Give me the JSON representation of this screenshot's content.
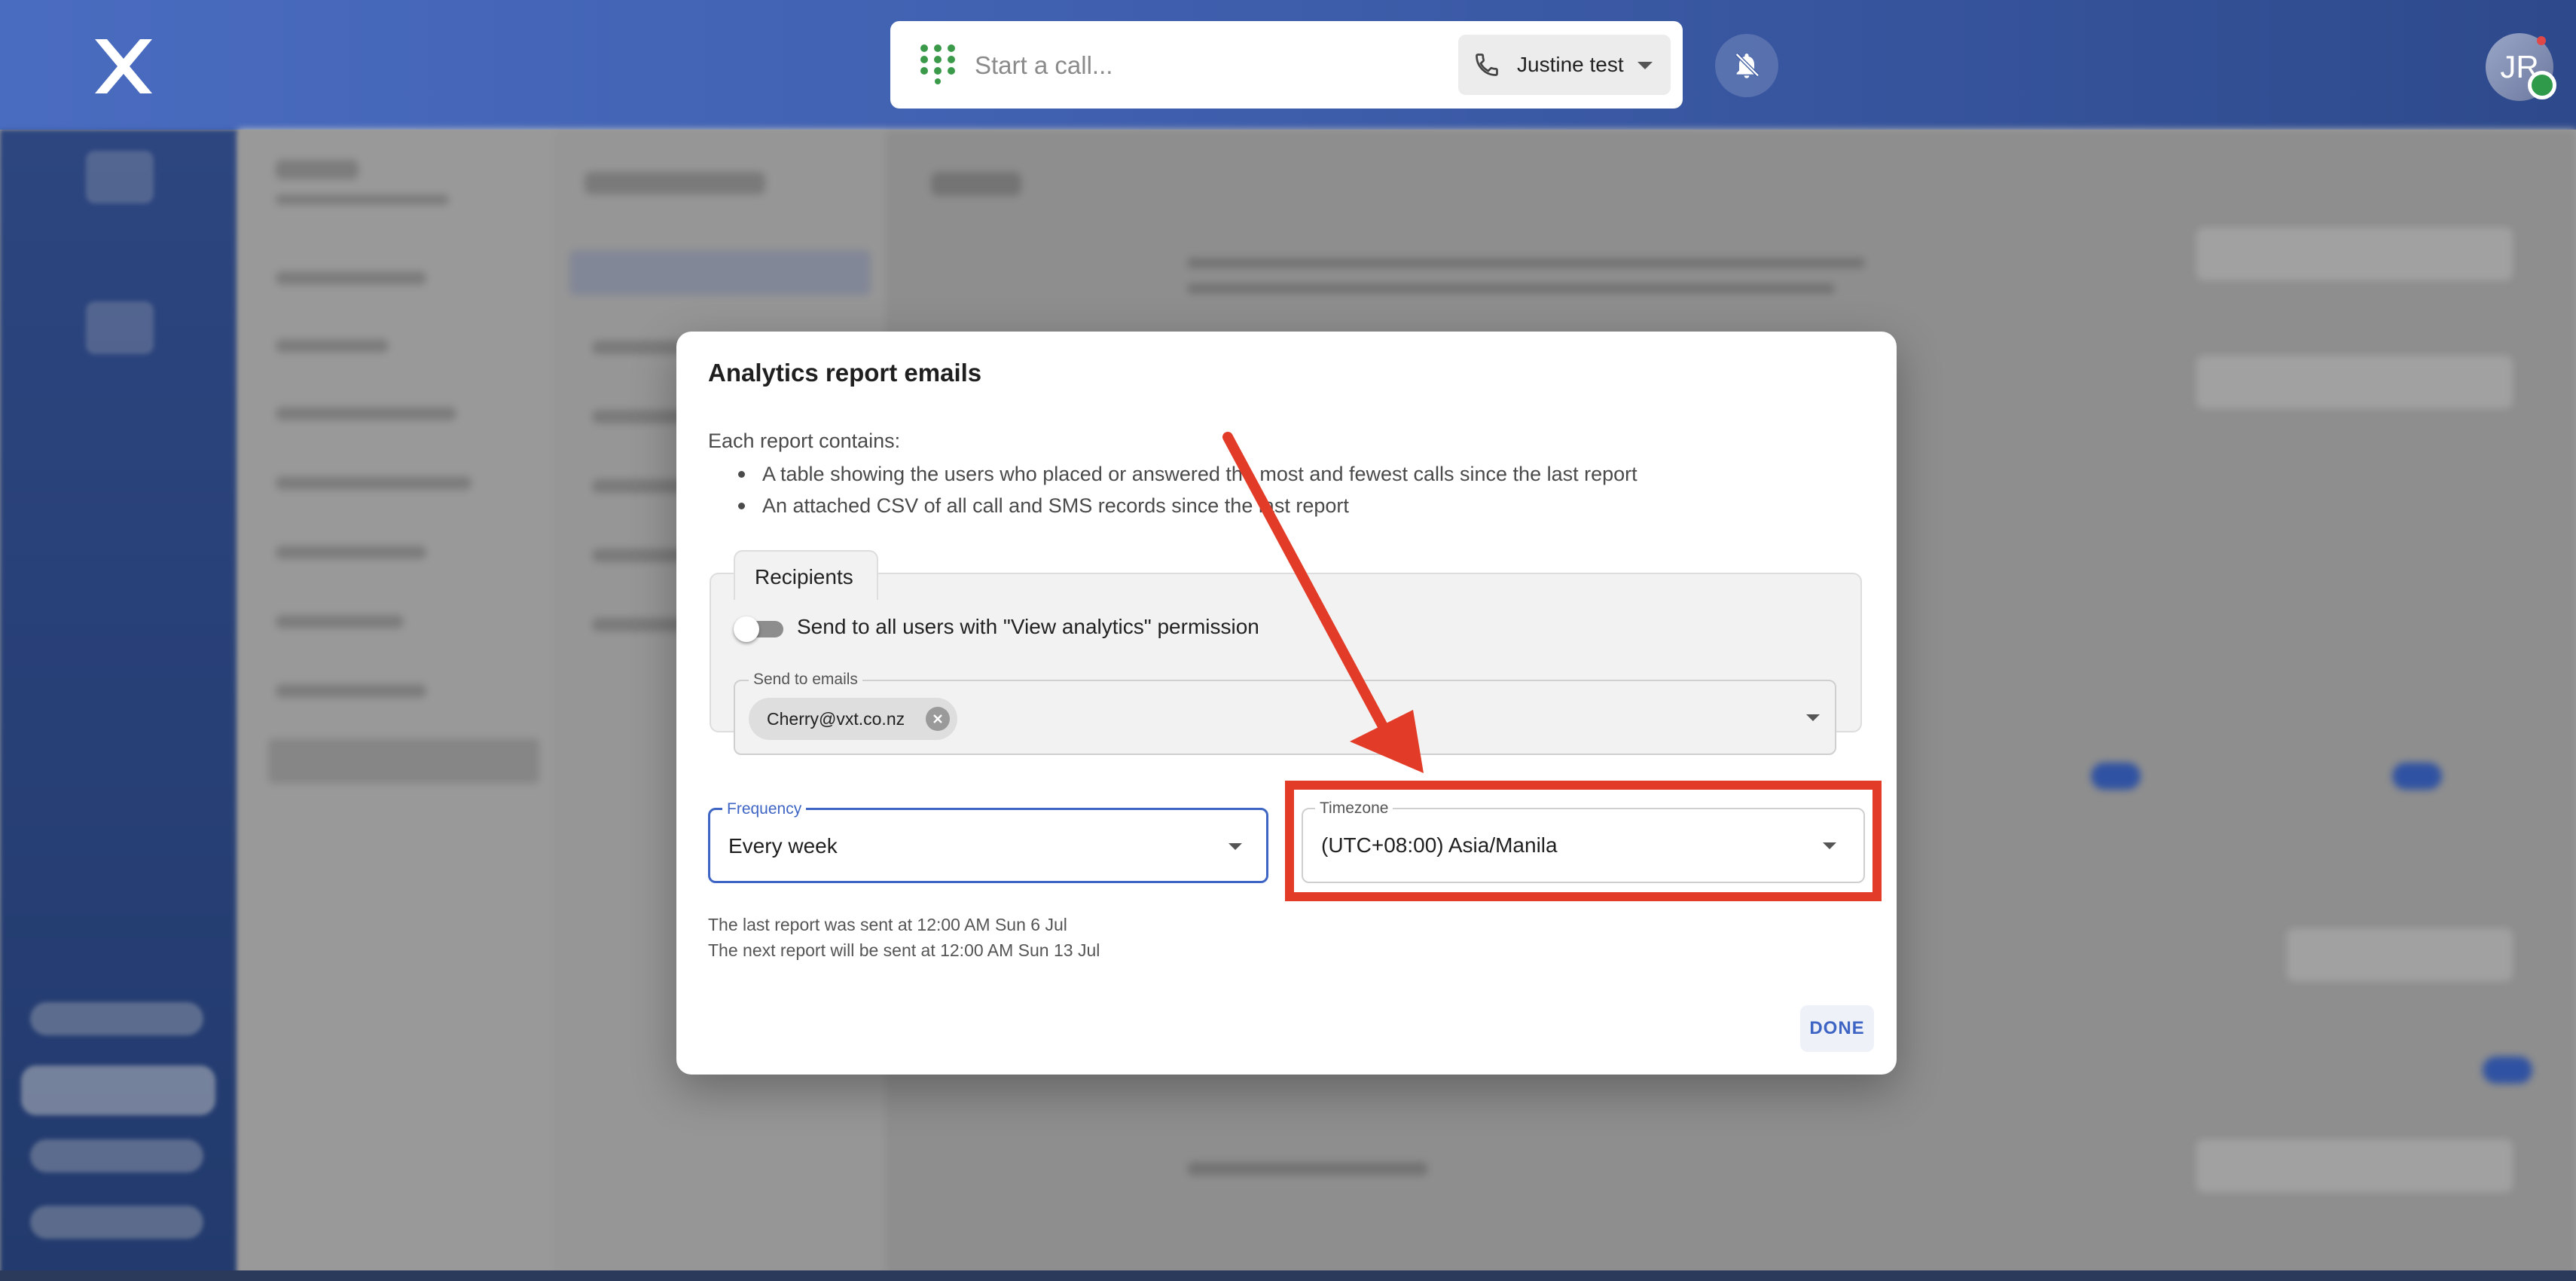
{
  "topbar": {
    "logo_icon": "vxt-x-logo",
    "call_placeholder": "Start a call...",
    "line_selector": "Justine test",
    "avatar_initials": "JR",
    "status_color": "#2e9a4a"
  },
  "dialog": {
    "title": "Analytics report emails",
    "intro": "Each report contains:",
    "bullets": [
      "A table showing the users who placed or answered the most and fewest calls since the last report",
      "An attached CSV of all call and SMS records since the last report"
    ],
    "recipients": {
      "tab_label": "Recipients",
      "toggle_label": "Send to all users with \"View analytics\" permission",
      "toggle_on": false,
      "emails_label": "Send to emails",
      "emails": [
        "Cherry@vxt.co.nz"
      ]
    },
    "frequency": {
      "label": "Frequency",
      "value": "Every week"
    },
    "timezone": {
      "label": "Timezone",
      "value": "(UTC+08:00) Asia/Manila"
    },
    "last_report": "The last report was sent at 12:00 AM Sun 6 Jul",
    "next_report": "The next report will be sent at 12:00 AM Sun 13 Jul",
    "done_label": "DONE"
  },
  "annotation": {
    "color": "#e23c28"
  },
  "accent_color": "#3f65c4"
}
